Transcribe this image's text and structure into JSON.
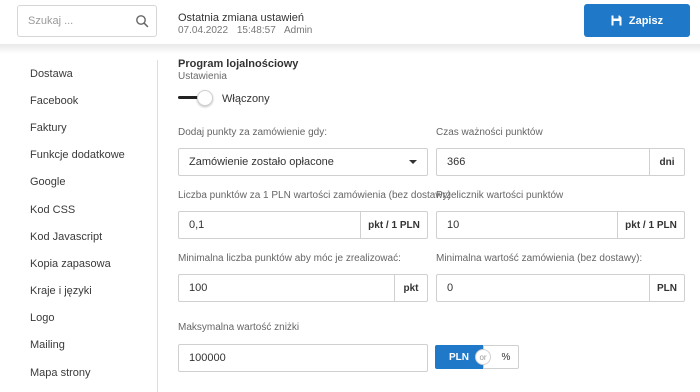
{
  "search": {
    "placeholder": "Szukaj ..."
  },
  "header": {
    "title": "Ostatnia zmiana ustawień",
    "date": "07.04.2022",
    "time": "15:48:57",
    "user": "Admin"
  },
  "toolbar": {
    "save_label": "Zapisz",
    "accent": "#1f78c8"
  },
  "sidebar": {
    "items": [
      {
        "label": "Dostawa"
      },
      {
        "label": "Facebook"
      },
      {
        "label": "Faktury"
      },
      {
        "label": "Funkcje dodatkowe"
      },
      {
        "label": "Google"
      },
      {
        "label": "Kod CSS"
      },
      {
        "label": "Kod Javascript"
      },
      {
        "label": "Kopia zapasowa"
      },
      {
        "label": "Kraje i języki"
      },
      {
        "label": "Logo"
      },
      {
        "label": "Mailing"
      },
      {
        "label": "Mapa strony"
      }
    ]
  },
  "section": {
    "title": "Program lojalnościowy",
    "subtitle": "Ustawienia",
    "toggle_label": "Włączony",
    "toggle_on": true
  },
  "form": {
    "add_points": {
      "label": "Dodaj punkty za zamówienie gdy:",
      "value": "Zamówienie zostało opłacone"
    },
    "validity": {
      "label": "Czas ważności punktów",
      "value": "366",
      "unit": "dni"
    },
    "points_per_pln": {
      "label": "Liczba punktów za 1 PLN wartości zamówienia (bez dostawy)",
      "value": "0,1",
      "unit": "pkt / 1 PLN"
    },
    "converter": {
      "label": "Przelicznik wartości punktów",
      "value": "10",
      "unit": "pkt / 1 PLN"
    },
    "min_points": {
      "label": "Minimalna liczba punktów aby móc je zrealizować:",
      "value": "100",
      "unit": "pkt"
    },
    "min_order": {
      "label": "Minimalna wartość zamówienia (bez dostawy):",
      "value": "0",
      "unit": "PLN"
    },
    "max_discount": {
      "label": "Maksymalna wartość zniżki",
      "value": "100000",
      "opt_pln": "PLN",
      "opt_or": "or",
      "opt_pct": "%"
    }
  }
}
